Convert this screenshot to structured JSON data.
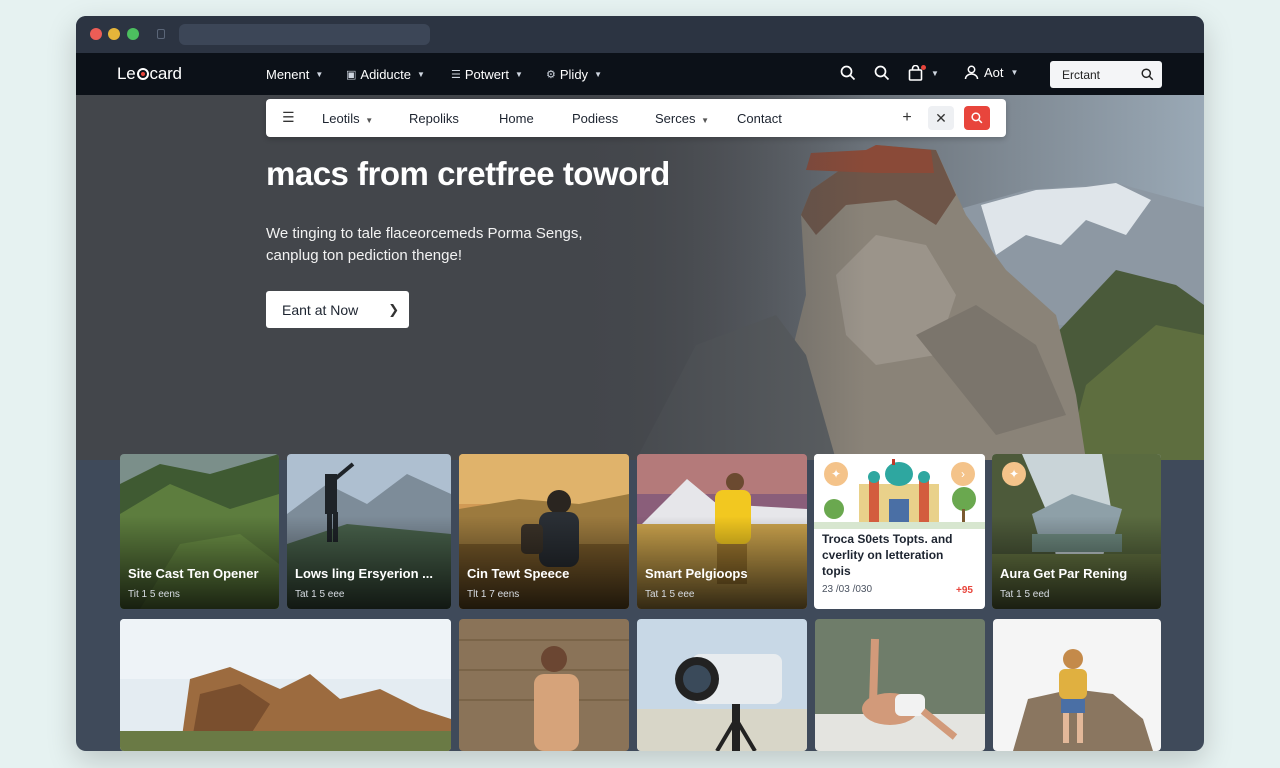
{
  "brand": {
    "logo": "Leocard",
    "logo_pre": "Le",
    "logo_post": "card"
  },
  "top_nav": {
    "items": [
      {
        "label": "Menent",
        "icon": "none"
      },
      {
        "label": "Adiducte",
        "icon": "doc-icon"
      },
      {
        "label": "Potwert",
        "icon": "list-icon"
      },
      {
        "label": "Plidy",
        "icon": "gear-icon"
      }
    ],
    "account_label": "Aot",
    "search_value": "Erctant"
  },
  "sub_nav": {
    "items": [
      "Leotils",
      "Repoliks",
      "Home",
      "Podiess",
      "Serces",
      "Contact"
    ]
  },
  "hero": {
    "title": "macs from cretfree toword",
    "subtitle": "We tinging to tale flaceorcemeds Porma Sengs, canplug ton pediction thenge!",
    "cta_label": "Eant at Now"
  },
  "cards_row1": [
    {
      "title": "Site Cast Ten Opener",
      "meta": "Tit 1 5 eens"
    },
    {
      "title": "Lows ling Ersyerion ...",
      "meta": "Tat 1 5 eee"
    },
    {
      "title": "Cin Tewt Speece",
      "meta": "Tlt 1 7 eens"
    },
    {
      "title": "Smart Pelgioops",
      "meta": "Tat 1 5 eee"
    },
    {
      "title": "Troca S0ets Topts. and cverlity on letteration topis",
      "meta": "23 /03 /030",
      "share": "+95"
    },
    {
      "title": "Aura Get Par Rening",
      "meta": "Tat 1 5 eed"
    }
  ],
  "colors": {
    "accent": "#e8453c",
    "nav_bg": "#0c1118",
    "window_bg": "#3f4a5a"
  }
}
